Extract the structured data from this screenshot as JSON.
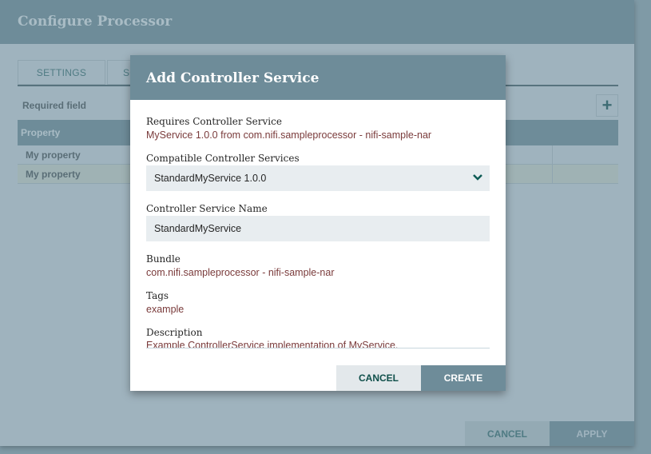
{
  "background_dialog": {
    "title": "Configure Processor",
    "tabs": [
      {
        "label": "SETTINGS"
      },
      {
        "label": "SC"
      }
    ],
    "required_field_label": "Required field",
    "add_icon": "plus-icon",
    "table": {
      "columns": [
        "Property"
      ],
      "rows": [
        {
          "property": "My property"
        },
        {
          "property": "My property"
        }
      ]
    },
    "buttons": {
      "cancel": "CANCEL",
      "apply": "APPLY"
    }
  },
  "modal": {
    "title": "Add Controller Service",
    "requires_label": "Requires Controller Service",
    "requires_value": "MyService 1.0.0 from com.nifi.sampleprocessor - nifi-sample-nar",
    "compatible_label": "Compatible Controller Services",
    "compatible_selected": "StandardMyService 1.0.0",
    "name_label": "Controller Service Name",
    "name_value": "StandardMyService",
    "bundle_label": "Bundle",
    "bundle_value": "com.nifi.sampleprocessor - nifi-sample-nar",
    "tags_label": "Tags",
    "tags_value": "example",
    "description_label": "Description",
    "description_value": "Example ControllerService implementation of MyService.",
    "buttons": {
      "cancel": "CANCEL",
      "create": "CREATE"
    }
  },
  "colors": {
    "header": "#6e8c99",
    "accent_text": "#7a3b3b",
    "primary_button": "#6e8c99",
    "secondary_button": "#e3e8eb"
  }
}
